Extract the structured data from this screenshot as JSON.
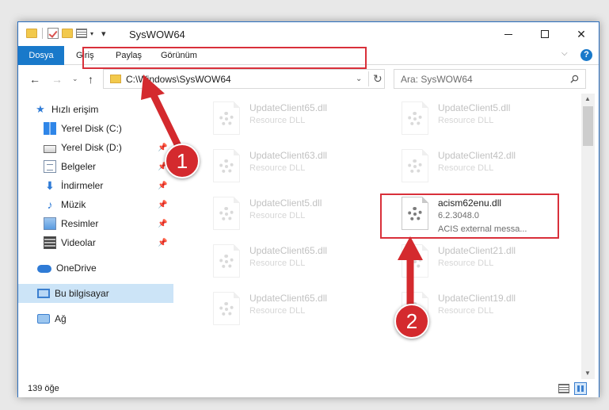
{
  "window": {
    "title": "SysWOW64",
    "minimize_label": "",
    "maximize_label": "",
    "close_label": "✕"
  },
  "ribbon": {
    "tabs": [
      {
        "label": "Dosya"
      },
      {
        "label": "Giriş"
      },
      {
        "label": "Paylaş"
      },
      {
        "label": "Görünüm"
      }
    ],
    "help": "?"
  },
  "nav": {
    "address": "C:\\Windows\\SysWOW64",
    "search_placeholder": "Ara: SysWOW64"
  },
  "sidebar": {
    "items": [
      {
        "label": "Hızlı erişim",
        "icon": "star-icon",
        "pinned": false
      },
      {
        "label": "Yerel Disk (C:)",
        "icon": "windows-drive-icon",
        "pinned": false
      },
      {
        "label": "Yerel Disk (D:)",
        "icon": "drive-icon",
        "pinned": true
      },
      {
        "label": "Belgeler",
        "icon": "documents-icon",
        "pinned": true
      },
      {
        "label": "İndirmeler",
        "icon": "downloads-icon",
        "pinned": true
      },
      {
        "label": "Müzik",
        "icon": "music-icon",
        "pinned": true
      },
      {
        "label": "Resimler",
        "icon": "pictures-icon",
        "pinned": true
      },
      {
        "label": "Videolar",
        "icon": "videos-icon",
        "pinned": true
      },
      {
        "label": "OneDrive",
        "icon": "cloud-icon",
        "pinned": false
      },
      {
        "label": "Bu bilgisayar",
        "icon": "computer-icon",
        "pinned": false,
        "selected": true
      },
      {
        "label": "Ağ",
        "icon": "network-icon",
        "pinned": false
      }
    ]
  },
  "files": [
    {
      "name": "UpdateClient65.dll",
      "type": "Resource DLL",
      "faded": true
    },
    {
      "name": "UpdateClient5.dll",
      "type": "Resource DLL",
      "faded": true
    },
    {
      "name": "UpdateClient63.dll",
      "type": "Resource DLL",
      "faded": true
    },
    {
      "name": "UpdateClient42.dll",
      "type": "Resource DLL",
      "faded": true
    },
    {
      "name": "UpdateClient5.dll",
      "type": "Resource DLL",
      "faded": true
    },
    {
      "name": "acism62enu.dll",
      "version": "6.2.3048.0",
      "description": "ACIS external messa...",
      "faded": false
    },
    {
      "name": "UpdateClient65.dll",
      "type": "Resource DLL",
      "faded": true
    },
    {
      "name": "UpdateClient21.dll",
      "type": "Resource DLL",
      "faded": true
    },
    {
      "name": "UpdateClient65.dll",
      "type": "Resource DLL",
      "faded": true
    },
    {
      "name": "UpdateClient19.dll",
      "type": "Resource DLL",
      "faded": true
    }
  ],
  "status": {
    "item_count": "139 öğe"
  },
  "annotations": {
    "step1": "1",
    "step2": "2",
    "highlight_color": "#d9303a",
    "badge_color": "#d42a2e"
  },
  "colors": {
    "accent": "#1979ca",
    "selection": "#cce4f7"
  }
}
